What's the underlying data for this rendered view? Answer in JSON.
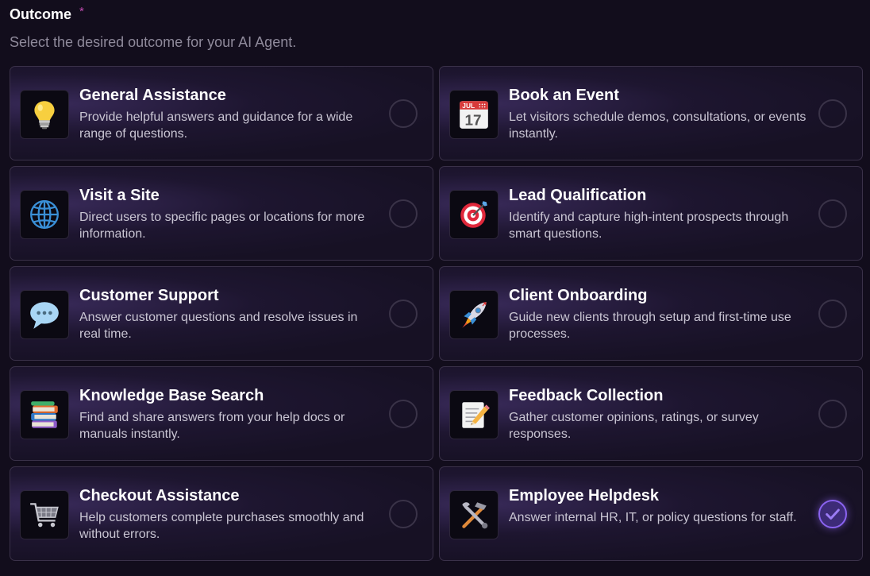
{
  "header": {
    "title": "Outcome",
    "required_mark": "*",
    "subtitle": "Select the desired outcome for your AI Agent."
  },
  "options": [
    {
      "title": "General Assistance",
      "description": "Provide helpful answers and guidance for a wide range of questions.",
      "icon": "lightbulb-icon",
      "selected": false
    },
    {
      "title": "Book an Event",
      "description": "Let visitors schedule demos, consultations, or events instantly.",
      "icon": "calendar-icon",
      "calendar_month": "JUL",
      "calendar_day": "17",
      "selected": false
    },
    {
      "title": "Visit a Site",
      "description": "Direct users to specific pages or locations for more information.",
      "icon": "globe-icon",
      "selected": false
    },
    {
      "title": "Lead Qualification",
      "description": "Identify and capture high-intent prospects through smart questions.",
      "icon": "target-icon",
      "selected": false
    },
    {
      "title": "Customer Support",
      "description": "Answer customer questions and resolve issues in real time.",
      "icon": "speech-bubble-icon",
      "selected": false
    },
    {
      "title": "Client Onboarding",
      "description": "Guide new clients through setup and first-time use processes.",
      "icon": "rocket-icon",
      "selected": false
    },
    {
      "title": "Knowledge Base Search",
      "description": "Find and share answers from your help docs or manuals instantly.",
      "icon": "books-icon",
      "selected": false
    },
    {
      "title": "Feedback Collection",
      "description": "Gather customer opinions, ratings, or survey responses.",
      "icon": "memo-icon",
      "selected": false
    },
    {
      "title": "Checkout Assistance",
      "description": "Help customers complete purchases smoothly and without errors.",
      "icon": "shopping-cart-icon",
      "selected": false
    },
    {
      "title": "Employee Helpdesk",
      "description": "Answer internal HR, IT, or policy questions for staff.",
      "icon": "tools-icon",
      "selected": true
    }
  ],
  "colors": {
    "accent": "#8a63f0",
    "required": "#c04bb0",
    "background": "#120d1c"
  }
}
